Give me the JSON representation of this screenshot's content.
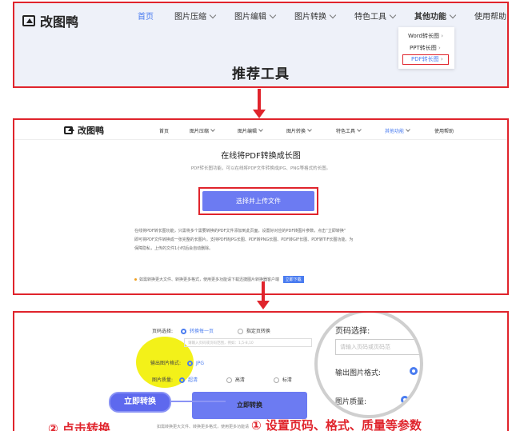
{
  "brand": "改图鸭",
  "nav": [
    "首页",
    "图片压缩",
    "图片编辑",
    "图片转换",
    "特色工具",
    "其他功能",
    "使用帮助"
  ],
  "dropdown": [
    "Word转长图",
    "PPT转长图",
    "PDF转长图"
  ],
  "panel1": {
    "heading": "推荐工具"
  },
  "panel2": {
    "title": "在线将PDF转换成长图",
    "subtitle": "PDF转长图功能，可以在线将PDF文件转换成JPG、PNG等格式的长图。",
    "upload_button": "选择并上传文件",
    "desc_line1": "在线将PDF转长图功能，只需将多个需要转换的PDF文件添加到此页面，设置好对应的PDF转图片参数，点击“立即转换”",
    "desc_line2": "即可将PDF文件转换成一张完整的长图片。支持PDF转JPG长图、PDF转PNG长图、PDF转GIF长图、PDF转TIF长图功能。为",
    "desc_line3": "保障隐私，上传的文件1小时后会自动删除。",
    "note": "如需转换更大文件、转换更多格式，使用更多功能请下载迅捷图片转换器客户端",
    "download_button": "立即下载"
  },
  "panel3": {
    "page_select_label": "页码选择:",
    "page_opt1": "转换每一页",
    "page_opt2": "指定页转换",
    "page_input_placeholder": "请输入页码或页码范围，例如：1,5-8,10",
    "format_label": "输出图片格式:",
    "format_opt1": "JPG",
    "quality_label": "图片质量:",
    "quality_opt1": "超清",
    "quality_opt2": "高清",
    "quality_opt3": "标清",
    "convert_button": "立即转换",
    "note": "如需转换更大文件、转换更多格式，使用更多功能请",
    "zoom_page_label": "页码选择:",
    "zoom_input_placeholder": "请输入页码或页码范",
    "zoom_format_label": "输出图片格式:",
    "zoom_quality_label": "图片质量:",
    "callout": "立即转换",
    "step2": "② 点击转换",
    "step1": "① 设置页码、格式、质量等参数"
  },
  "colors": {
    "accent": "#e0242c",
    "primary": "#6c7bf2",
    "nav_active": "#4a7cf0",
    "highlight": "#f2ef00"
  }
}
